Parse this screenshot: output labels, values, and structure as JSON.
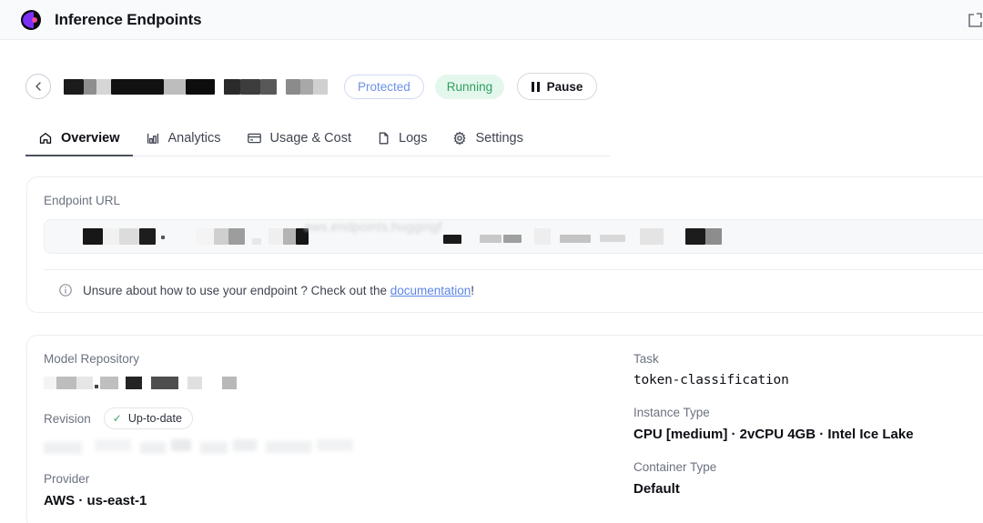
{
  "topbar": {
    "title": "Inference Endpoints",
    "logo_icon": "huggingface-endpoints-logo",
    "right_icon": "external-link-icon"
  },
  "endpoint": {
    "back_icon": "arrow-left-icon",
    "name_redacted": true,
    "badges": {
      "protected": "Protected",
      "status": "Running"
    },
    "pause_button": {
      "label": "Pause",
      "icon": "pause-icon"
    }
  },
  "tabs": [
    {
      "label": "Overview",
      "icon": "home-icon",
      "active": true
    },
    {
      "label": "Analytics",
      "icon": "bar-chart-icon",
      "active": false
    },
    {
      "label": "Usage & Cost",
      "icon": "card-icon",
      "active": false
    },
    {
      "label": "Logs",
      "icon": "file-icon",
      "active": false
    },
    {
      "label": "Settings",
      "icon": "gear-icon",
      "active": false
    }
  ],
  "url_card": {
    "label": "Endpoint URL",
    "value_redacted": true,
    "ghost_text": "aws.endpoints.huggingf",
    "note": {
      "icon": "info-circle-icon",
      "text_before": "Unsure about how to use your endpoint ? Check out the ",
      "link": "documentation",
      "text_after": "!"
    }
  },
  "info_card": {
    "left": {
      "model_repository_label": "Model Repository",
      "model_repository_redacted": true,
      "revision_label": "Revision",
      "revision_badge": "Up-to-date",
      "revision_badge_icon": "check-icon",
      "revision_redacted": true,
      "provider_label": "Provider",
      "provider_value": "AWS · us-east-1"
    },
    "right": {
      "task_label": "Task",
      "task_value": "token-classification",
      "instance_type_label": "Instance Type",
      "instance_type_value": "CPU [medium] · 2vCPU 4GB · Intel Ice Lake",
      "container_type_label": "Container Type",
      "container_type_value": "Default"
    }
  },
  "colors": {
    "accent_link": "#5b86e5",
    "status_running": "#2f9e5f",
    "status_running_bg": "#e4f7ec",
    "protected": "#6b92e8",
    "check_green": "#3fa96a",
    "border": "#eceef1",
    "label_gray": "#6b7280"
  }
}
